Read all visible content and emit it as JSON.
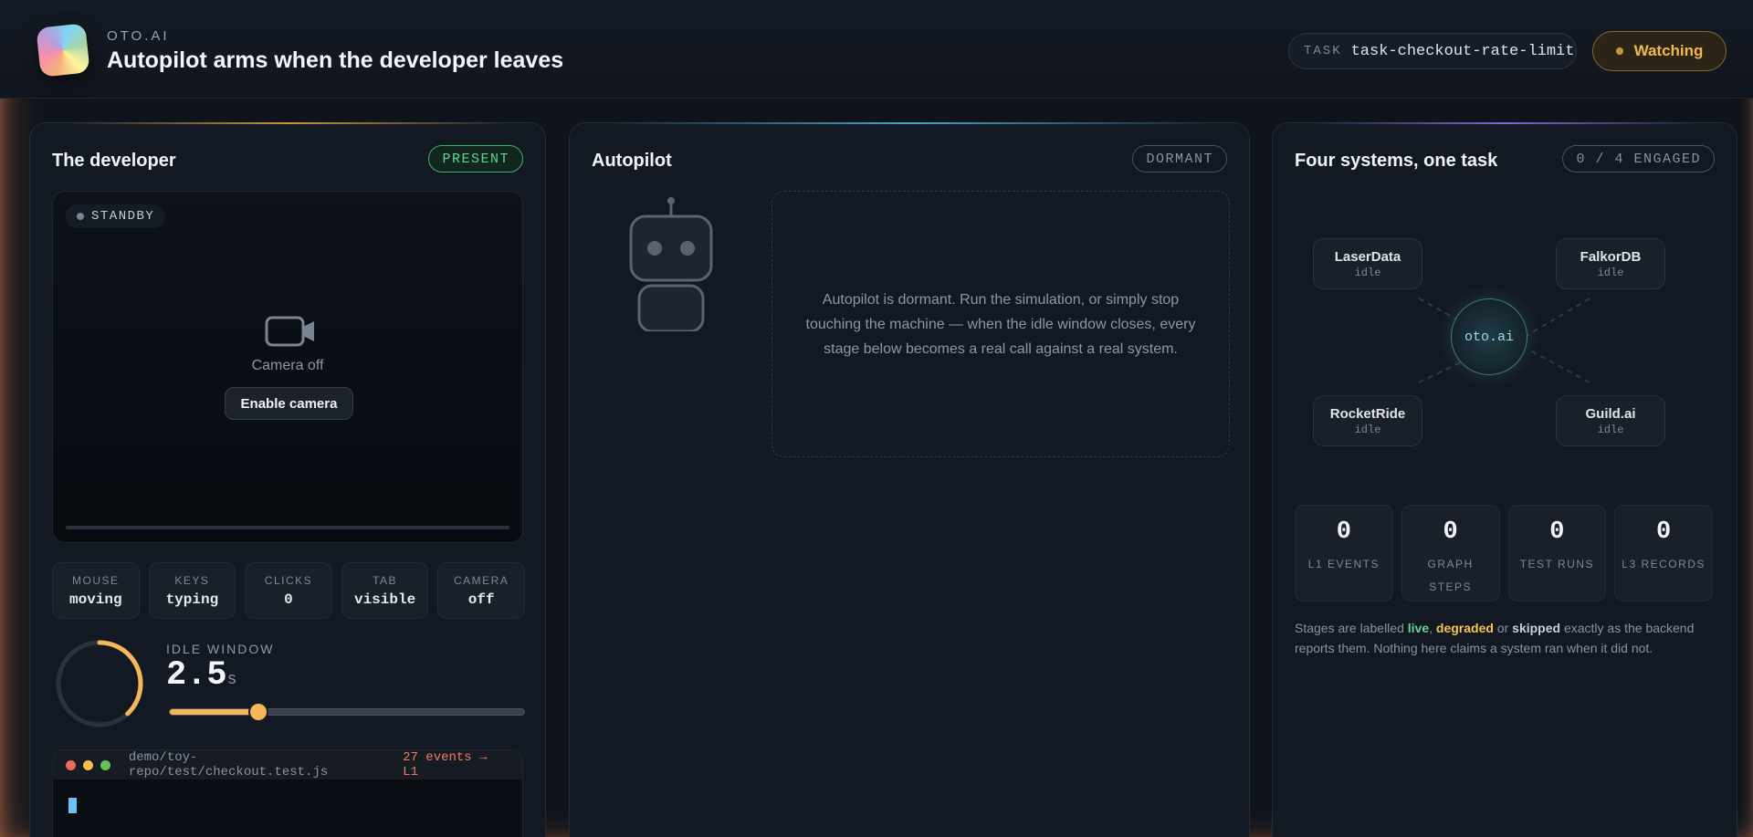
{
  "header": {
    "brand": "OTO.AI",
    "title": "Autopilot arms when the developer leaves",
    "task_key": "TASK",
    "task_value": "task-checkout-rate-limit",
    "status": "Watching"
  },
  "developer": {
    "title": "The developer",
    "badge": "PRESENT",
    "camera": {
      "standby": "STANDBY",
      "message": "Camera off",
      "button": "Enable camera"
    },
    "stats": [
      {
        "key": "MOUSE",
        "value": "moving"
      },
      {
        "key": "KEYS",
        "value": "typing"
      },
      {
        "key": "CLICKS",
        "value": "0"
      },
      {
        "key": "TAB",
        "value": "visible"
      },
      {
        "key": "CAMERA",
        "value": "off"
      }
    ],
    "idle": {
      "label": "IDLE WINDOW",
      "value": "2.5",
      "unit": "s",
      "slider_fraction": 0.25,
      "ring_fraction": 0.38
    },
    "terminal": {
      "path": "demo/toy-repo/test/checkout.test.js",
      "events": "27 events → L1"
    }
  },
  "autopilot": {
    "title": "Autopilot",
    "badge": "DORMANT",
    "message": "Autopilot is dormant. Run the simulation, or simply stop touching the machine — when the idle window closes, every stage below becomes a real call against a real system."
  },
  "systems": {
    "title": "Four systems, one task",
    "badge": "0 / 4 ENGAGED",
    "hub": "oto.ai",
    "nodes": [
      {
        "name": "LaserData",
        "status": "idle"
      },
      {
        "name": "FalkorDB",
        "status": "idle"
      },
      {
        "name": "RocketRide",
        "status": "idle"
      },
      {
        "name": "Guild.ai",
        "status": "idle"
      }
    ],
    "counters": [
      {
        "value": "0",
        "label": "L1 EVENTS"
      },
      {
        "value": "0",
        "label": "GRAPH STEPS"
      },
      {
        "value": "0",
        "label": "TEST RUNS"
      },
      {
        "value": "0",
        "label": "L3 RECORDS"
      }
    ],
    "note": {
      "prefix": "Stages are labelled ",
      "live": "live",
      "sep1": ", ",
      "degraded": "degraded",
      "sep2": " or ",
      "skipped": "skipped",
      "suffix": " exactly as the backend reports them. Nothing here claims a system ran when it did not."
    }
  },
  "colors": {
    "accent_present": "#5fd597",
    "accent_watching": "#f3b84d",
    "slider": "#f5b75a",
    "terminal_events": "#f07e5c"
  }
}
